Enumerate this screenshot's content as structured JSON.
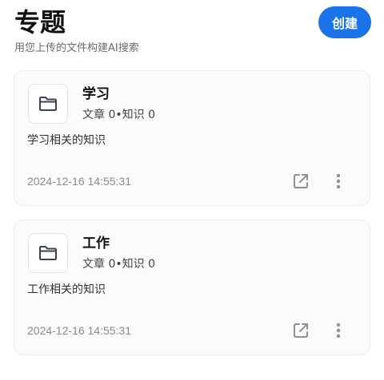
{
  "header": {
    "title": "专题",
    "subtitle": "用您上传的文件构建AI搜索",
    "create_label": "创建"
  },
  "topics": [
    {
      "title": "学习",
      "stats": "文章 0•知识 0",
      "description": "学习相关的知识",
      "date": "2024-12-16 14:55:31",
      "icon": "folder-icon"
    },
    {
      "title": "工作",
      "stats": "文章 0•知识 0",
      "description": "工作相关的知识",
      "date": "2024-12-16 14:55:31",
      "icon": "folder-icon"
    }
  ],
  "colors": {
    "accent": "#1a73e8",
    "icon": "#8c8f96"
  }
}
